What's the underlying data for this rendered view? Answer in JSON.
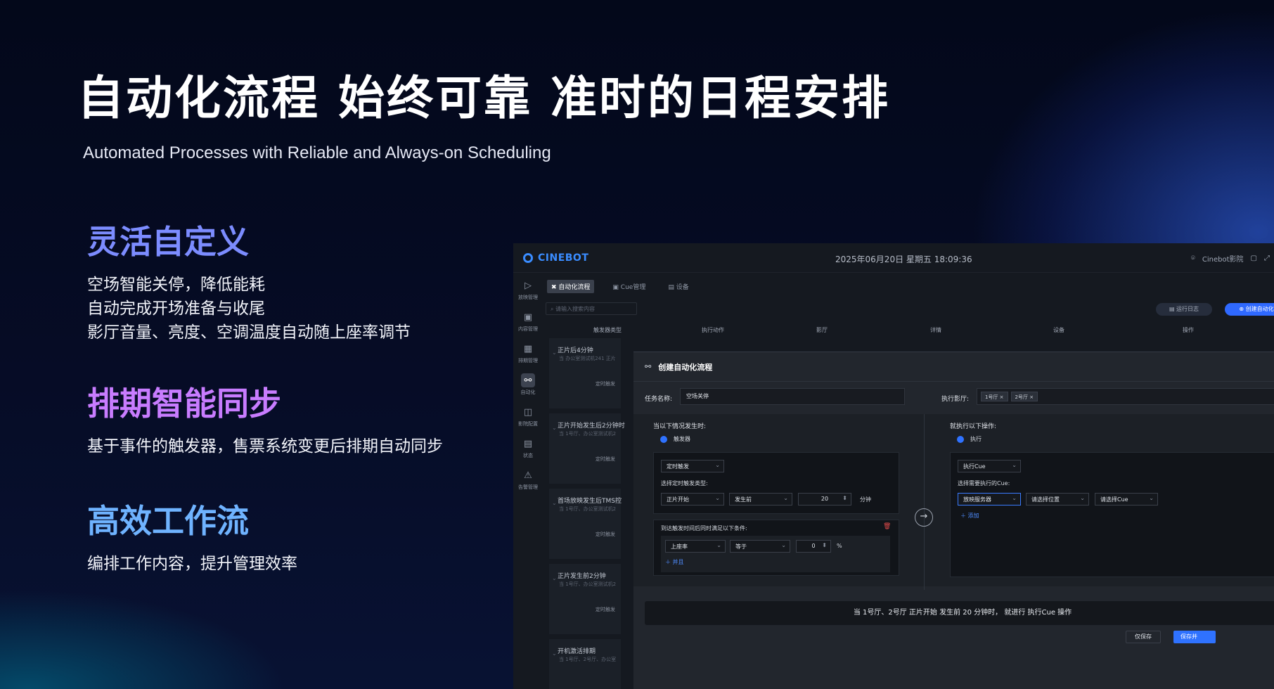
{
  "hero": {
    "title": "自动化流程 始终可靠 准时的日程安排",
    "subtitle": "Automated Processes with Reliable and Always-on Scheduling"
  },
  "features": [
    {
      "heading": "灵活自定义",
      "lines": [
        "空场智能关停，降低能耗",
        "自动完成开场准备与收尾",
        "影厅音量、亮度、空调温度自动随上座率调节"
      ]
    },
    {
      "heading": "排期智能同步",
      "lines": [
        "基于事件的触发器，售票系统变更后排期自动同步"
      ]
    },
    {
      "heading": "高效工作流",
      "lines": [
        "编排工作内容，提升管理效率"
      ]
    }
  ],
  "app": {
    "brand": "CINEBOT",
    "datetime": "2025年06月20日 星期五 18:09:36",
    "cinema_name": "Cinebot影院",
    "sidebar": [
      {
        "label": "放映管理",
        "icon": "projector-icon"
      },
      {
        "label": "内容管理",
        "icon": "content-icon"
      },
      {
        "label": "排期管理",
        "icon": "calendar-icon"
      },
      {
        "label": "自动化",
        "icon": "automation-icon",
        "active": true
      },
      {
        "label": "影院配置",
        "icon": "config-icon"
      },
      {
        "label": "状态",
        "icon": "status-icon"
      },
      {
        "label": "告警管理",
        "icon": "alert-icon"
      }
    ],
    "tabs": [
      {
        "label": "自动化流程",
        "active": true
      },
      {
        "label": "Cue管理"
      },
      {
        "label": "设备"
      }
    ],
    "search_placeholder": "请输入搜索内容",
    "run_log_label": "运行日志",
    "create_label": "创建自动化",
    "table_headers": [
      "触发器类型",
      "执行动作",
      "影厅",
      "详情",
      "设备",
      "操作"
    ],
    "list_items": [
      {
        "title": "正片后4分钟",
        "sub": "当 办公室测试机241  正片",
        "trigger": "定时触发"
      },
      {
        "title": "正片开始发生后2分钟时",
        "sub": "当 1号厅、办公室测试机2",
        "trigger": "定时触发"
      },
      {
        "title": "首场放映发生后TMS控",
        "sub": "当 1号厅、办公室测试机2",
        "trigger": "定时触发"
      },
      {
        "title": "正片发生前2分钟",
        "sub": "当 1号厅、办公室测试机2",
        "trigger": "定时触发"
      },
      {
        "title": "开机激活排期",
        "sub": "当 1号厅、2号厅、办公室",
        "trigger": ""
      }
    ],
    "modal": {
      "title": "创建自动化流程",
      "task_name_label": "任务名称:",
      "task_name_value": "空场关停",
      "hall_label": "执行影厅:",
      "halls": [
        "1号厅 ×",
        "2号厅 ×"
      ],
      "when_label": "当以下情况发生时:",
      "trigger_radio": "触发器",
      "trigger_type": "定时触发",
      "timer_type_label": "选择定时触发类型:",
      "timer_event": "正片开始",
      "timer_relation": "发生前",
      "timer_value": "20",
      "timer_unit": "分钟",
      "condition_label": "到达触发时间后同时满足以下条件:",
      "cond_field": "上座率",
      "cond_op": "等于",
      "cond_value": "0",
      "cond_unit": "%",
      "and_label": "＋ 并且",
      "then_label": "就执行以下操作:",
      "exec_radio": "执行",
      "action_type": "执行Cue",
      "select_cue_label": "选择需要执行的Cue:",
      "server_select": "放映服务器",
      "position_select": "请选择位置",
      "cue_select": "请选择Cue",
      "add_label": "＋ 添加",
      "summary": "当 1号厅、2号厅  正片开始 发生前 20 分钟时，  就进行 执行Cue 操作",
      "save_label": "仅保存",
      "save_go_label": "保存并"
    }
  }
}
